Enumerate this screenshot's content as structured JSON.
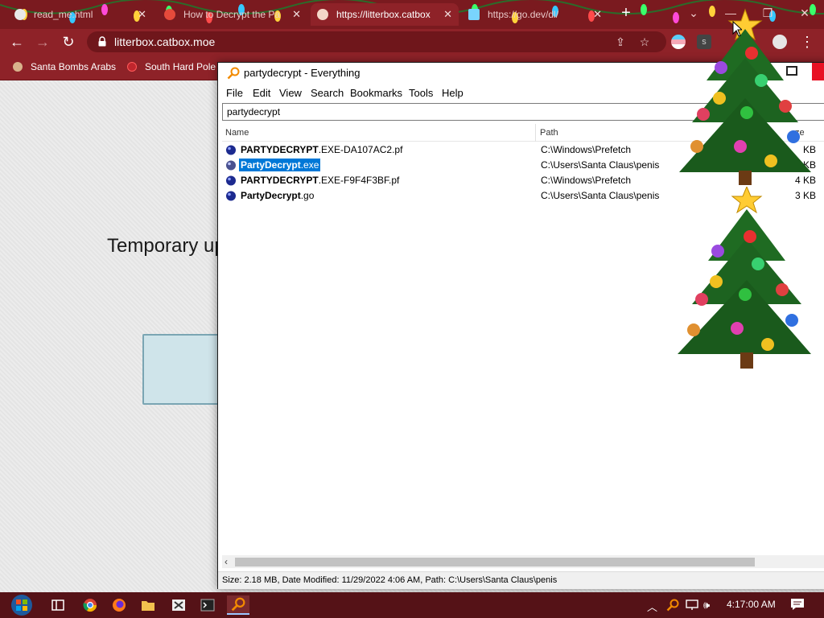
{
  "browser": {
    "tabs": [
      {
        "title": "read_me.html",
        "active": false
      },
      {
        "title": "How to Decrypt the Pa",
        "active": false
      },
      {
        "title": "https://litterbox.catbox",
        "active": true
      },
      {
        "title": "https://go.dev/dl/",
        "active": false
      }
    ],
    "close_glyph": "✕",
    "new_tab_glyph": "+",
    "url": "litterbox.catbox.moe",
    "bookmarks": [
      "Santa Bombs Arabs",
      "South Hard Pole"
    ],
    "extension_label": "s"
  },
  "page": {
    "heading": "Temporary up"
  },
  "everything": {
    "title": "partydecrypt - Everything",
    "menu": [
      "File",
      "Edit",
      "View",
      "Search",
      "Bookmarks",
      "Tools",
      "Help"
    ],
    "search_value": "partydecrypt",
    "columns": {
      "name": "Name",
      "path": "Path",
      "size": "ze"
    },
    "rows": [
      {
        "name_bold": "PARTYDECRYPT",
        "name_rest": ".EXE-DA107AC2.pf",
        "path": "C:\\Windows\\Prefetch",
        "size": "KB",
        "selected": false
      },
      {
        "name_bold": "PartyDecrypt",
        "name_rest": ".exe",
        "path": "C:\\Users\\Santa Claus\\penis",
        "size": "224 KB",
        "selected": true
      },
      {
        "name_bold": "PARTYDECRYPT",
        "name_rest": ".EXE-F9F4F3BF.pf",
        "path": "C:\\Windows\\Prefetch",
        "size": "4 KB",
        "selected": false
      },
      {
        "name_bold": "PartyDecrypt",
        "name_rest": ".go",
        "path": "C:\\Users\\Santa Claus\\penis",
        "size": "3 KB",
        "selected": false
      }
    ],
    "status": "Size: 2.18 MB, Date Modified: 11/29/2022 4:06 AM, Path: C:\\Users\\Santa Claus\\penis"
  },
  "taskbar": {
    "clock": "4:17:00 AM"
  },
  "colors": {
    "chrome_frame": "#7a1a1f",
    "chrome_toolbar": "#8e2228",
    "selection": "#0078d7",
    "taskbar": "#551217"
  }
}
